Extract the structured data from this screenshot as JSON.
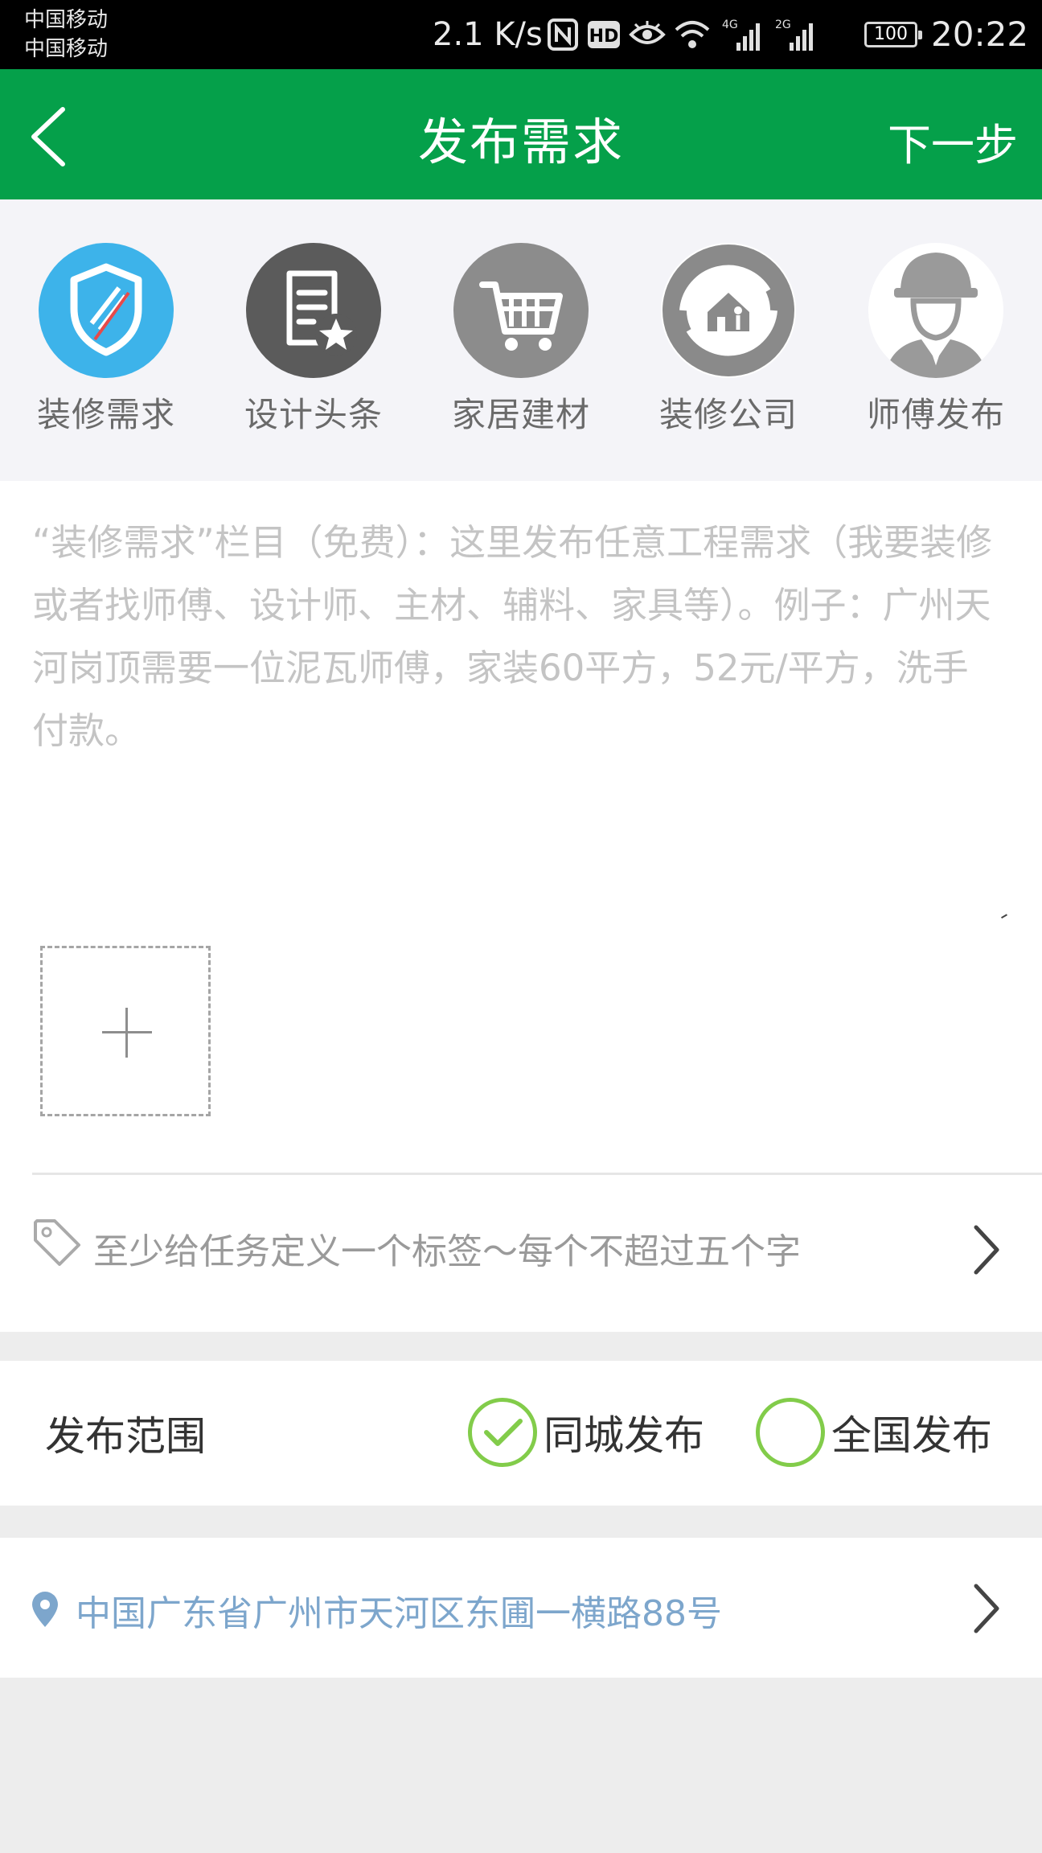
{
  "status_bar": {
    "carrier_1": "中国移动",
    "carrier_2": "中国移动",
    "net_speed": "2.1 K/s",
    "icons": [
      "nfc-icon",
      "hd-icon",
      "eye-icon",
      "wifi-icon",
      "signal-4g-icon",
      "signal-2g-icon",
      "battery-icon"
    ],
    "net_label_1": "4G",
    "net_label_2": "2G",
    "battery": "100",
    "time": "20:22"
  },
  "nav": {
    "title": "发布需求",
    "next": "下一步",
    "back_icon": "chevron-left-icon"
  },
  "categories": [
    {
      "label": "装修需求",
      "icon": "shield-icon",
      "color": "#3db3ea",
      "selected": true
    },
    {
      "label": "设计头条",
      "icon": "article-star-icon",
      "color": "#5b5b5b"
    },
    {
      "label": "家居建材",
      "icon": "cart-icon",
      "color": "#8c8c8c"
    },
    {
      "label": "装修公司",
      "icon": "house-cycle-icon",
      "color": "#8a8a8a"
    },
    {
      "label": "师傅发布",
      "icon": "worker-icon",
      "color": "#9a9a9a"
    }
  ],
  "editor": {
    "placeholder": "“装修需求”栏目（免费）：这里发布任意工程需求（我要装修或者找师傅、设计师、主材、辅料、家具等）。例子：广州天河岗顶需要一位泥瓦师傅，家装60平方，52元/平方，洗手付款。",
    "add_image_icon": "plus-icon"
  },
  "tags": {
    "placeholder": "至少给任务定义一个标签～每个不超过五个字",
    "icon": "tag-icon"
  },
  "range": {
    "label": "发布范围",
    "options": [
      {
        "label": "同城发布",
        "checked": true
      },
      {
        "label": "全国发布",
        "checked": false
      }
    ]
  },
  "location": {
    "address": "中国广东省广州市天河区东圃一横路88号",
    "icon": "location-pin-icon"
  },
  "colors": {
    "nav_green": "#05a04a",
    "check_green": "#82cc4a",
    "address_blue": "#7da6cc",
    "selected_blue": "#3db3ea"
  }
}
